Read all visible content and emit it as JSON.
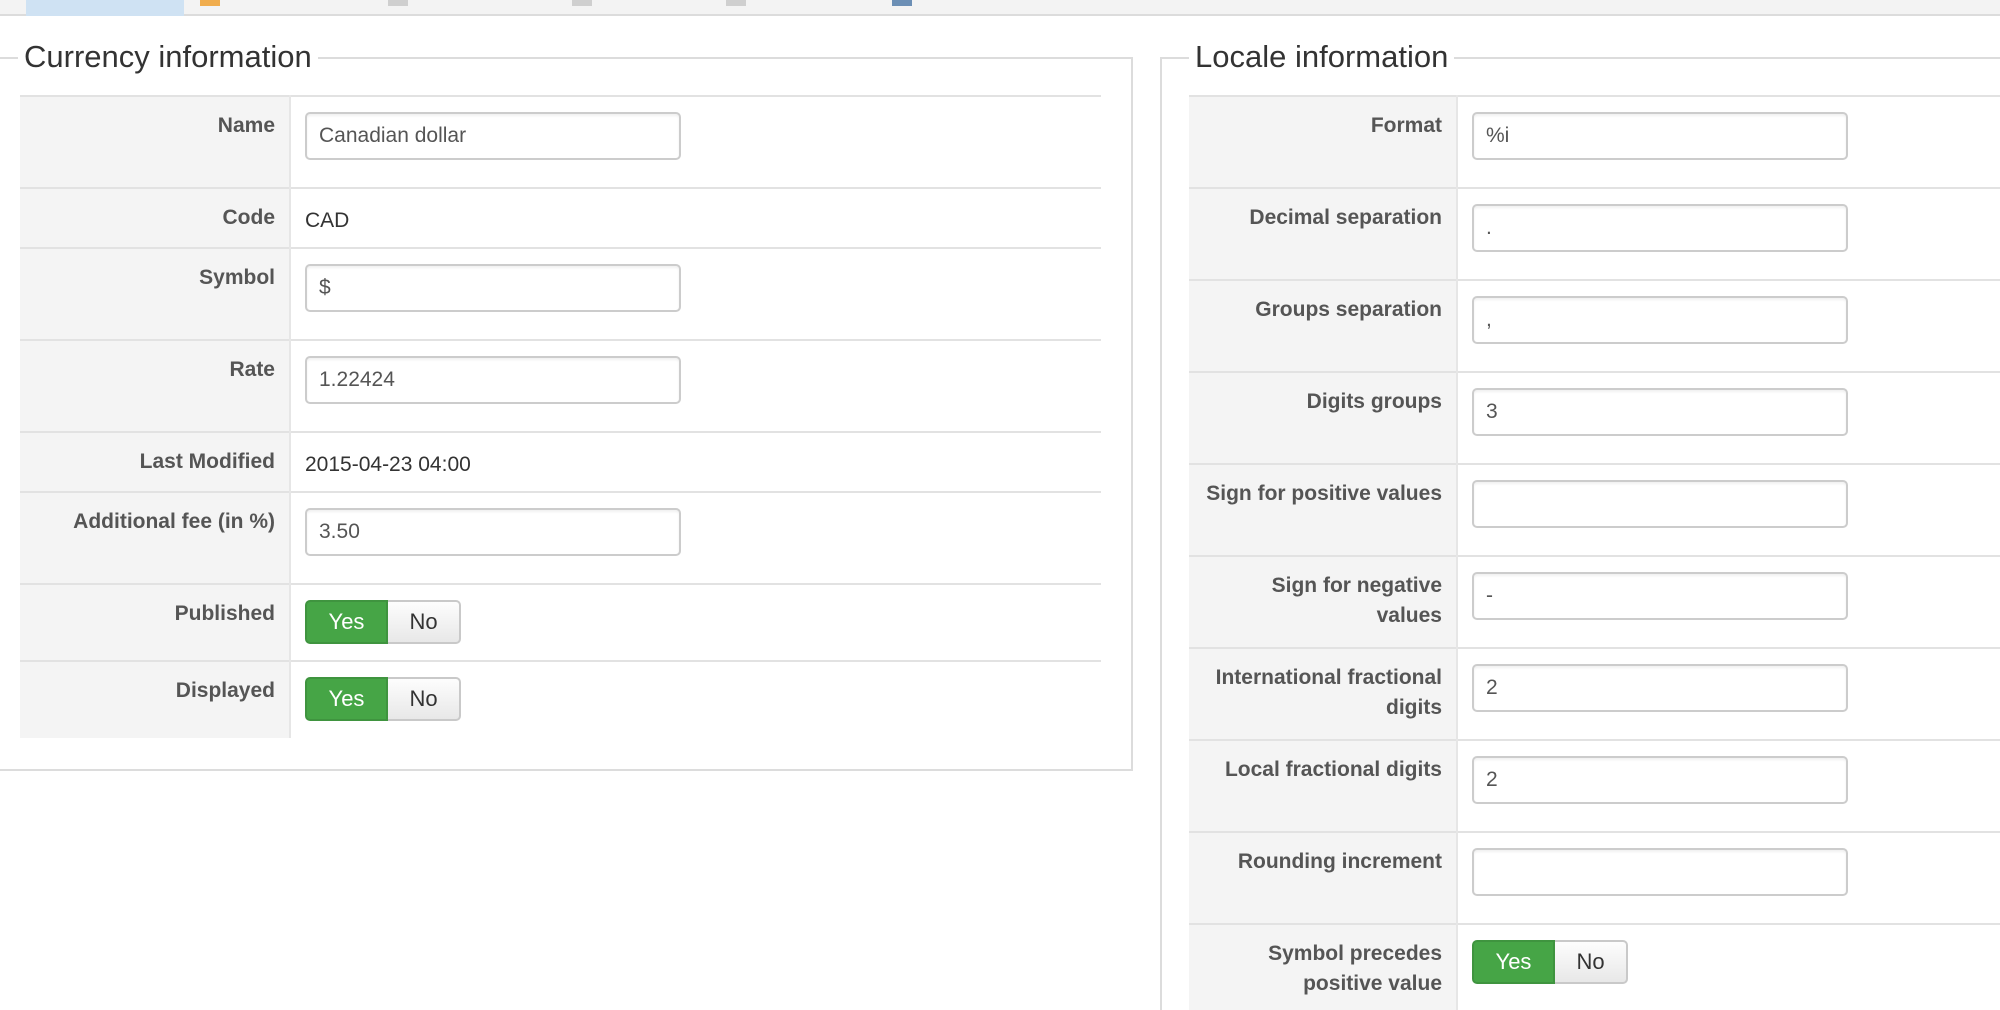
{
  "currency": {
    "title": "Currency information",
    "name_label": "Name",
    "name_value": "Canadian dollar",
    "code_label": "Code",
    "code_value": "CAD",
    "symbol_label": "Symbol",
    "symbol_value": "$",
    "rate_label": "Rate",
    "rate_value": "1.22424",
    "modified_label": "Last Modified",
    "modified_value": "2015-04-23 04:00",
    "fee_label": "Additional fee (in %)",
    "fee_value": "3.50",
    "published_label": "Published",
    "displayed_label": "Displayed"
  },
  "toggle": {
    "yes": "Yes",
    "no": "No",
    "active_color": "#46a546"
  },
  "locale": {
    "title": "Locale information",
    "format_label": "Format",
    "format_value": "%i",
    "decimal_label": "Decimal separation",
    "decimal_value": ".",
    "groups_label": "Groups separation",
    "groups_value": ",",
    "digits_label": "Digits groups",
    "digits_value": "3",
    "positive_sign_label": "Sign for positive values",
    "positive_sign_value": "",
    "negative_sign_label": "Sign for negative values",
    "negative_sign_value": "-",
    "intl_digits_label": "International fractional digits",
    "intl_digits_value": "2",
    "local_digits_label": "Local fractional digits",
    "local_digits_value": "2",
    "rounding_label": "Rounding increment",
    "rounding_value": "",
    "precedes_label": "Symbol precedes positive value"
  }
}
